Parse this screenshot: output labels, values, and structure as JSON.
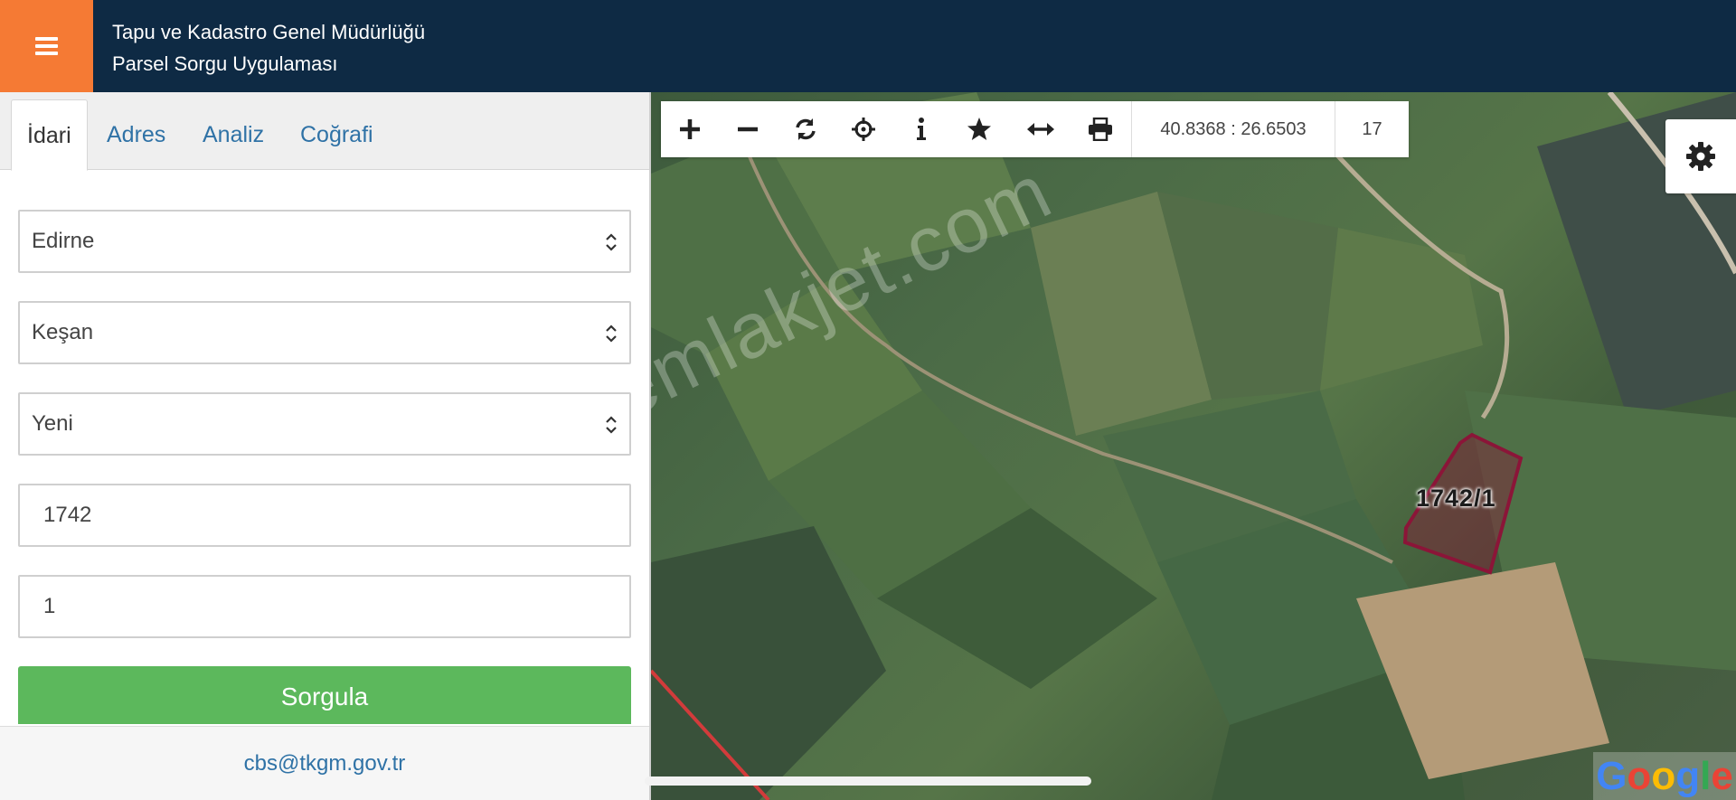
{
  "header": {
    "menu_icon": "hamburger-menu-icon",
    "title_line1": "Tapu ve Kadastro Genel Müdürlüğü",
    "title_line2": "Parsel Sorgu Uygulaması"
  },
  "tabs": [
    {
      "label": "İdari",
      "active": true
    },
    {
      "label": "Adres",
      "active": false
    },
    {
      "label": "Analiz",
      "active": false
    },
    {
      "label": "Coğrafi",
      "active": false
    }
  ],
  "form": {
    "province": "Edirne",
    "district": "Keşan",
    "neighborhood": "Yeni",
    "block": "1742",
    "parcel": "1",
    "submit_label": "Sorgula"
  },
  "footer": {
    "email": "cbs@tkgm.gov.tr"
  },
  "toolbar": {
    "icons": [
      "zoom-in-icon",
      "zoom-out-icon",
      "refresh-icon",
      "locate-icon",
      "info-icon",
      "star-icon",
      "measure-icon",
      "print-icon"
    ],
    "coordinates": "40.8368 : 26.6503",
    "zoom_level": "17"
  },
  "map": {
    "watermark": "emlakjet.com",
    "parcel_label": "1742/1",
    "attribution": "Google",
    "settings_icon": "gear-icon"
  },
  "colors": {
    "header_bg": "#0e2a44",
    "menu_button": "#f57a34",
    "link": "#2f72a6",
    "submit_bg": "#5cb85c",
    "parcel_outline": "#8b1538"
  }
}
